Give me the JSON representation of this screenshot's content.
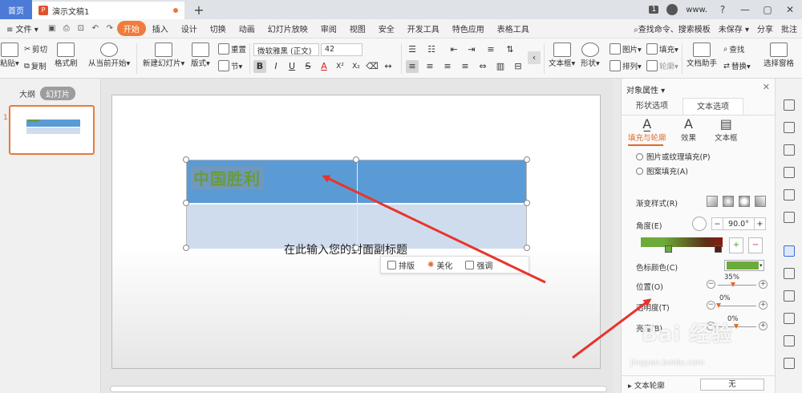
{
  "titlebar": {
    "home_tab": "首页",
    "doc_tab": "演示文稿1",
    "new_tab": "+",
    "page_count": "1",
    "user": "www.",
    "help": "?",
    "minimize": "—",
    "restore": "▢",
    "close": "✕"
  },
  "menubar": {
    "file": "≡ 文件 ▾",
    "items": [
      "开始",
      "插入",
      "设计",
      "切换",
      "动画",
      "幻灯片放映",
      "审阅",
      "视图",
      "安全",
      "开发工具",
      "特色应用",
      "表格工具"
    ],
    "search": "查找命令、搜索模板",
    "unsaved": "未保存 ▾",
    "share": "分享",
    "comment": "批注"
  },
  "ribbon": {
    "paste": "粘贴▾",
    "cut": "剪切",
    "copy": "复制",
    "format_painter": "格式刷",
    "from_current": "从当前开始▾",
    "new_slide": "新建幻灯片▾",
    "layout": "版式▾",
    "reset": "重置",
    "section": "节▾",
    "font_name": "微软雅黑 (正文)",
    "font_size": "42",
    "bold": "B",
    "italic": "I",
    "underline": "U",
    "strike": "S",
    "superscript": "X²",
    "subscript": "X₂",
    "text_box": "文本框▾",
    "shape": "形状▾",
    "arrange": "排列▾",
    "outline": "轮廓▾",
    "picture": "图片▾",
    "fill": "填充▾",
    "doc_helper": "文档助手",
    "find": "查找",
    "replace": "替换▾",
    "select_pane": "选择窗格"
  },
  "leftpanel": {
    "tab_outline": "大纲",
    "tab_slides": "幻灯片",
    "slide_number": "1"
  },
  "slide": {
    "table_title": "中国胜利",
    "subtitle": "在此输入您的封面副标题",
    "floatbar": {
      "layout": "排版",
      "beautify": "美化",
      "emphasis": "强调",
      "more": "›"
    }
  },
  "rightpanel": {
    "title": "对象属性 ▾",
    "close": "✕",
    "tabs": [
      "形状选项",
      "文本选项"
    ],
    "subtabs": [
      "填充与轮廓",
      "效果",
      "文本框"
    ],
    "fill_picture": "图片或纹理填充(P)",
    "fill_pattern": "图案填充(A)",
    "gradient_style": "渐变样式(R)",
    "angle_label": "角度(E)",
    "angle_value": "90.0°",
    "stop_color": "色标颜色(C)",
    "position_label": "位置(O)",
    "position_value": "35%",
    "transparency_label": "透明度(T)",
    "transparency_value": "0%",
    "brightness_label": "亮度(B)",
    "brightness_value": "0%",
    "text_outline": "文本轮廓",
    "outline_value": "无"
  },
  "watermark": {
    "brand": "Bai 经验",
    "url": "jingyan.baidu.com"
  },
  "colors": {
    "accent": "#f07b3b",
    "table_header": "#5b9bd5",
    "table_body": "#cfdcee",
    "text_green": "#6a9b3a",
    "arrow_red": "#e8342c"
  }
}
